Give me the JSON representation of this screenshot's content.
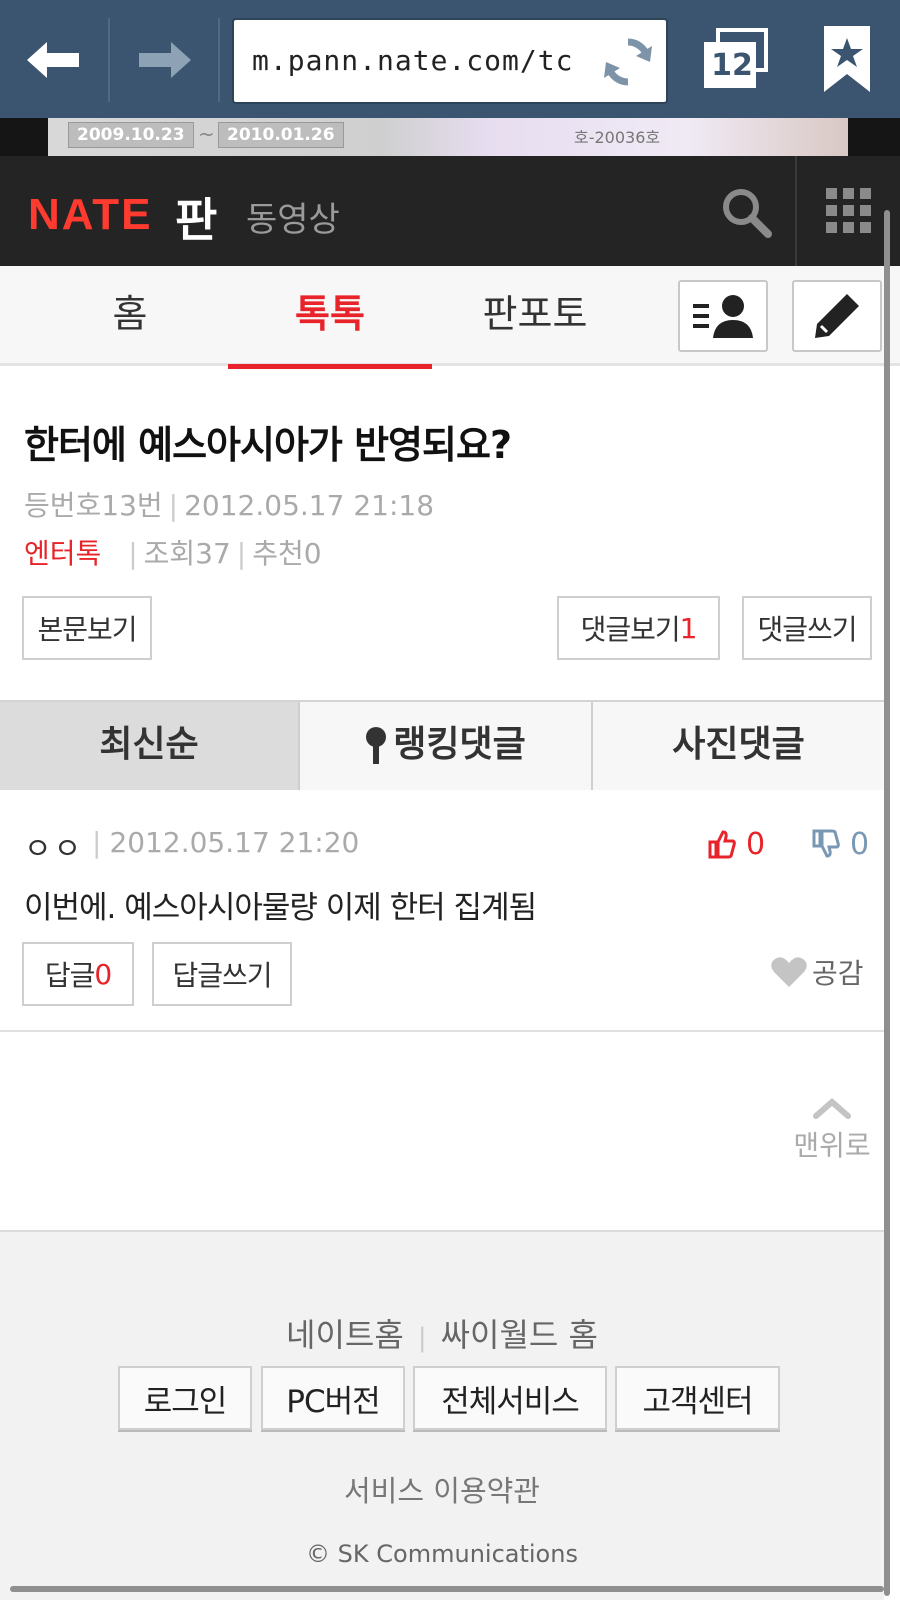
{
  "browser": {
    "url": "m.pann.nate.com/tc",
    "tab_count": "12",
    "icons": [
      "back-arrow-icon",
      "forward-arrow-icon",
      "reload-icon",
      "tabs-icon",
      "bookmark-star-icon"
    ]
  },
  "ad": {
    "date_start": "2009.10.23",
    "date_sep": "~",
    "date_end": "2010.01.26",
    "fragment": "호-20036호"
  },
  "header": {
    "logo": "NATE",
    "section": "판",
    "video_link": "동영상"
  },
  "tabs": [
    {
      "label": "홈"
    },
    {
      "label": "톡톡",
      "active": true
    },
    {
      "label": "판포토"
    }
  ],
  "article": {
    "title": "한터에 예스아시아가 반영되요?",
    "author_label": "등번호13번",
    "datetime": "2012.05.17 21:18",
    "category": "엔터톡",
    "views_label": "조회37",
    "recommend_label": "추천0"
  },
  "buttons": {
    "view_body": "본문보기",
    "view_comments": "댓글보기",
    "comment_count": "1",
    "write_comment": "댓글쓰기"
  },
  "sort_tabs": {
    "latest": "최신순",
    "ranking": "랭킹댓글",
    "photo": "사진댓글"
  },
  "comment": {
    "author": "ㅇㅇ",
    "datetime": "2012.05.17 21:20",
    "likes": "0",
    "dislikes": "0",
    "text": "이번에. 예스아시아물량 이제 한터 집계됨",
    "reply_label": "답글",
    "reply_count": "0",
    "reply_write": "답글쓰기",
    "empathy": "공감"
  },
  "to_top": "맨위로",
  "footer": {
    "link_nate_home": "네이트홈",
    "link_cyworld_home": "싸이월드 홈",
    "btn_login": "로그인",
    "btn_pc": "PC버전",
    "btn_all_services": "전체서비스",
    "btn_customer_center": "고객센터",
    "terms": "서비스 이용약관",
    "copyright": "© SK Communications"
  },
  "colors": {
    "browser_bar": "#3b5570",
    "nate_red": "#e8232a",
    "header_bg": "#242424"
  }
}
